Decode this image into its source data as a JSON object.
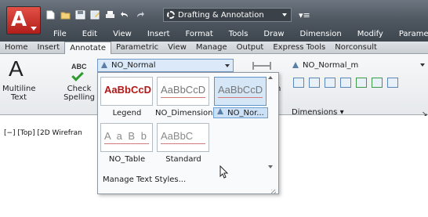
{
  "title_bar": {
    "workspace": "Drafting & Annotation",
    "menu": [
      "File",
      "Edit",
      "View",
      "Insert",
      "Format",
      "Tools",
      "Draw",
      "Dimension",
      "Modify",
      "Parametric"
    ]
  },
  "ribbon_tabs": [
    "Home",
    "Insert",
    "Annotate",
    "Parametric",
    "View",
    "Manage",
    "Output",
    "Express Tools",
    "Norconsult"
  ],
  "active_tab": "Annotate",
  "text_panel": {
    "multiline_label_1": "Multiline",
    "multiline_label_2": "Text",
    "check_icon_text": "ABC",
    "check_label_1": "Check",
    "check_label_2": "Spelling",
    "text_style": "NO_Normal",
    "big_a": "A",
    "partial_label": "n"
  },
  "dimensions_panel": {
    "dim_style": "NO_Normal_m",
    "panel_label": "Dimensions",
    "expand_glyph": "▾",
    "corner_glyph": "↘"
  },
  "viewport_label": "[−] [Top] [2D Wirefran",
  "gallery": {
    "styles": [
      {
        "name": "Legend",
        "preview": "AaBbCcD"
      },
      {
        "name": "NO_Dimension",
        "preview": "AaBbCcD"
      },
      {
        "name": "NO_Nor...",
        "preview": "AaBbCcD"
      },
      {
        "name": "NO_Table",
        "preview": "A a B b C"
      },
      {
        "name": "Standard",
        "preview": "AaBbC"
      }
    ],
    "selected": "NO_Nor...",
    "manage_label": "Manage Text Styles..."
  },
  "colors": {
    "accent_blue": "#5b7ea8",
    "app_red": "#c62a22",
    "legend_red": "#b01818"
  }
}
